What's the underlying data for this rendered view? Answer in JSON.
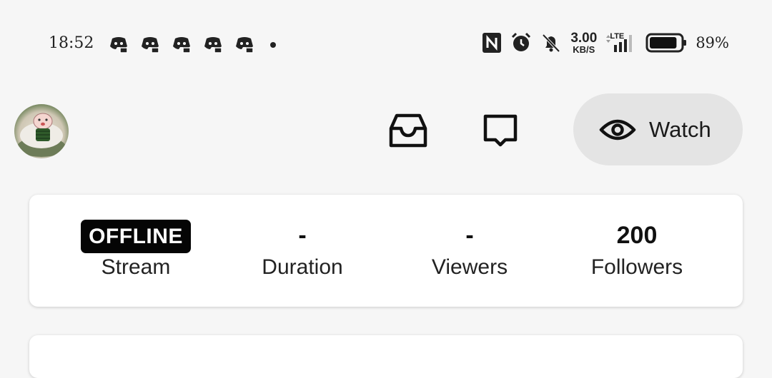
{
  "status_bar": {
    "time": "18:52",
    "notification_icons": [
      "discord-icon",
      "discord-icon",
      "discord-icon",
      "discord-icon",
      "discord-icon"
    ],
    "speed_value": "3.00",
    "speed_unit": "KB/S",
    "network_type": "LTE",
    "battery_percent": "89%",
    "battery_level": 0.89
  },
  "header": {
    "watch_label": "Watch"
  },
  "stats": {
    "stream_status": "OFFLINE",
    "stream_label": "Stream",
    "duration_value": "-",
    "duration_label": "Duration",
    "viewers_value": "-",
    "viewers_label": "Viewers",
    "followers_value": "200",
    "followers_label": "Followers"
  }
}
